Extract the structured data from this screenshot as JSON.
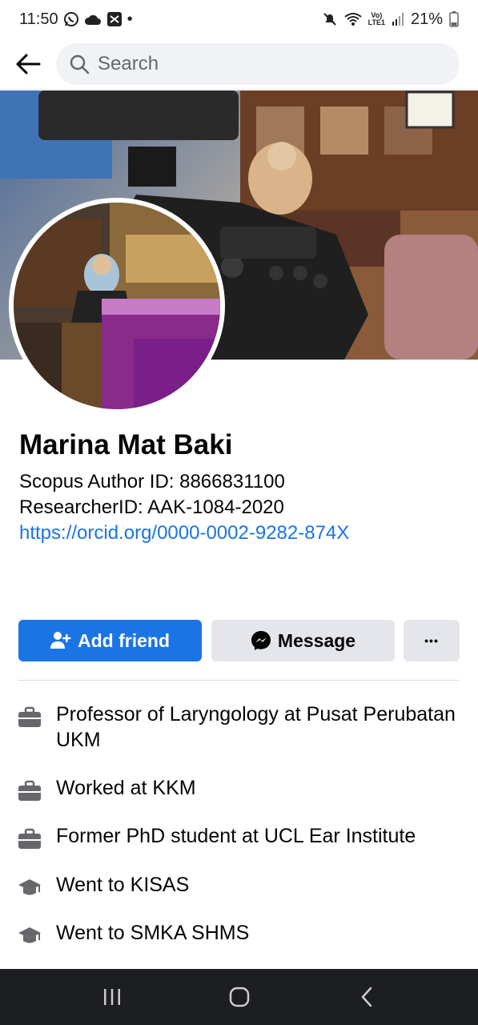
{
  "status_bar": {
    "time": "11:50",
    "dot": "•",
    "network_top": "Vo)",
    "network_bottom": "LTE1",
    "battery": "21%",
    "icons": [
      "whatsapp-icon",
      "cloud-icon",
      "gallery-icon",
      "mute-icon",
      "wifi-icon",
      "signal-icon",
      "battery-icon"
    ]
  },
  "search": {
    "placeholder": "Search"
  },
  "profile": {
    "name": "Marina Mat Baki",
    "bio": [
      "Scopus Author ID: 8866831100",
      "ResearcherID: AAK-1084-2020"
    ],
    "link": "https://orcid.org/0000-0002-9282-874X"
  },
  "actions": {
    "add_friend": "Add friend",
    "message": "Message",
    "more": "•••"
  },
  "details": [
    {
      "icon": "briefcase-icon",
      "text": "Professor of Laryngology at Pusat Perubatan UKM"
    },
    {
      "icon": "briefcase-icon",
      "text": "Worked at KKM"
    },
    {
      "icon": "briefcase-icon",
      "text": "Former PhD student at UCL Ear Institute"
    },
    {
      "icon": "graduation-cap-icon",
      "text": "Went to KISAS"
    },
    {
      "icon": "graduation-cap-icon",
      "text": "Went to SMKA SHMS"
    }
  ],
  "colors": {
    "accent": "#1b74e4",
    "secondary_button": "#e4e6eb",
    "nav_bar": "#1c1e21"
  }
}
